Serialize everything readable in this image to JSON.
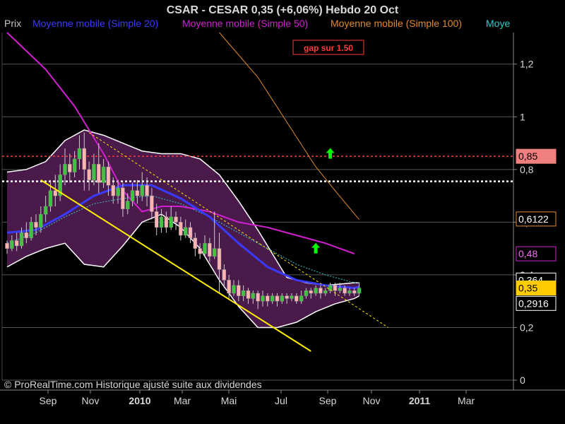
{
  "header": {
    "title": "CSAR - CESAR    0,35 (+6,06%)    Hebdo  20 Oct"
  },
  "legend": [
    {
      "label": "Prix",
      "color": "#c8c8c8"
    },
    {
      "label": "Moyenne mobile (Simple 20)",
      "color": "#3a3aff"
    },
    {
      "label": "Moyenne mobile (Simple 50)",
      "color": "#d21fd2"
    },
    {
      "label": "Moyenne mobile (Simple 100)",
      "color": "#e08a2e"
    },
    {
      "label": "Moye",
      "color": "#33cccc"
    }
  ],
  "annotation_gap": "gap sur 1.50",
  "footer": "© ProRealTime.com Historique ajusté suite aux dividendes",
  "colors": {
    "background": "#000000",
    "grid": "#555555",
    "bollinger_fill": "#4a1a4a",
    "bollinger_line": "#ffffff",
    "sma20": "#3a3aff",
    "sma50": "#d21fd2",
    "sma100": "#e08a2e",
    "extra": "#33cccc",
    "trendline": "#ffee00",
    "resistance": "#ff3b3b",
    "support": "#ffffff",
    "up_candle": "#3ec43e",
    "down_candle": "#ffb3b3",
    "arrow": "#00ff00"
  },
  "chart_data": {
    "type": "candlestick",
    "title": "CSAR - CESAR    0,35 (+6,06%)    Hebdo  20 Oct",
    "x_ticks": [
      {
        "label": "Sep",
        "bold": false
      },
      {
        "label": "Nov",
        "bold": false
      },
      {
        "label": "2010",
        "bold": true
      },
      {
        "label": "Mar",
        "bold": false
      },
      {
        "label": "Mai",
        "bold": false
      },
      {
        "label": "Jul",
        "bold": false
      },
      {
        "label": "Sep",
        "bold": false
      },
      {
        "label": "Nov",
        "bold": false
      },
      {
        "label": "2011",
        "bold": true
      },
      {
        "label": "Mar",
        "bold": false
      }
    ],
    "y_ticks": [
      "1,2",
      "1",
      "0,8",
      "0,6",
      "0,4",
      "0,2",
      "0"
    ],
    "y_tick_values": [
      1.2,
      1.0,
      0.8,
      0.6,
      0.4,
      0.2,
      0
    ],
    "ylim": [
      0,
      1.32
    ],
    "badges": [
      {
        "label": "0,85",
        "value": 0.85,
        "bg": "#f08080",
        "fg": "#000000",
        "border": "#f08080"
      },
      {
        "label": "0,6122",
        "value": 0.612,
        "bg": "#000000",
        "fg": "#ffffff",
        "border": "#e08a2e"
      },
      {
        "label": "0,48",
        "value": 0.48,
        "bg": "#000000",
        "fg": "#ff66ff",
        "border": "#d21fd2"
      },
      {
        "label": "0,364",
        "value": 0.38,
        "bg": "#000000",
        "fg": "#ffffff",
        "border": "#ffffff"
      },
      {
        "label": "0,35",
        "value": 0.35,
        "bg": "#ffcc00",
        "fg": "#000000",
        "border": "#ffcc00"
      },
      {
        "label": "0,2916",
        "value": 0.2916,
        "bg": "#000000",
        "fg": "#ffffff",
        "border": "#ffffff"
      }
    ],
    "levels": {
      "resistance": 0.85,
      "support": 0.755
    },
    "candles": [
      [
        0.52,
        0.5,
        0.48,
        0.53
      ],
      [
        0.5,
        0.53,
        0.49,
        0.55
      ],
      [
        0.53,
        0.51,
        0.49,
        0.56
      ],
      [
        0.51,
        0.56,
        0.5,
        0.58
      ],
      [
        0.56,
        0.54,
        0.52,
        0.6
      ],
      [
        0.54,
        0.6,
        0.53,
        0.62
      ],
      [
        0.6,
        0.58,
        0.55,
        0.63
      ],
      [
        0.58,
        0.63,
        0.56,
        0.66
      ],
      [
        0.63,
        0.66,
        0.6,
        0.7
      ],
      [
        0.66,
        0.72,
        0.64,
        0.76
      ],
      [
        0.72,
        0.7,
        0.66,
        0.78
      ],
      [
        0.7,
        0.78,
        0.68,
        0.82
      ],
      [
        0.78,
        0.82,
        0.74,
        0.88
      ],
      [
        0.82,
        0.79,
        0.75,
        0.86
      ],
      [
        0.79,
        0.84,
        0.77,
        0.87
      ],
      [
        0.84,
        0.88,
        0.8,
        0.93
      ],
      [
        0.88,
        0.8,
        0.72,
        0.94
      ],
      [
        0.8,
        0.76,
        0.72,
        0.83
      ],
      [
        0.76,
        0.82,
        0.74,
        0.86
      ],
      [
        0.82,
        0.75,
        0.71,
        0.9
      ],
      [
        0.75,
        0.81,
        0.73,
        0.84
      ],
      [
        0.81,
        0.74,
        0.7,
        0.83
      ],
      [
        0.74,
        0.7,
        0.67,
        0.77
      ],
      [
        0.7,
        0.73,
        0.67,
        0.76
      ],
      [
        0.73,
        0.65,
        0.62,
        0.75
      ],
      [
        0.65,
        0.68,
        0.63,
        0.71
      ],
      [
        0.68,
        0.72,
        0.66,
        0.75
      ],
      [
        0.72,
        0.7,
        0.67,
        0.76
      ],
      [
        0.7,
        0.74,
        0.68,
        0.79
      ],
      [
        0.74,
        0.7,
        0.66,
        0.77
      ],
      [
        0.7,
        0.64,
        0.61,
        0.73
      ],
      [
        0.64,
        0.58,
        0.55,
        0.67
      ],
      [
        0.58,
        0.62,
        0.56,
        0.65
      ],
      [
        0.62,
        0.58,
        0.56,
        0.64
      ],
      [
        0.58,
        0.62,
        0.57,
        0.66
      ],
      [
        0.62,
        0.6,
        0.57,
        0.64
      ],
      [
        0.6,
        0.55,
        0.53,
        0.62
      ],
      [
        0.55,
        0.58,
        0.54,
        0.61
      ],
      [
        0.58,
        0.54,
        0.52,
        0.6
      ],
      [
        0.54,
        0.5,
        0.47,
        0.56
      ],
      [
        0.5,
        0.48,
        0.46,
        0.52
      ],
      [
        0.48,
        0.52,
        0.47,
        0.55
      ],
      [
        0.52,
        0.47,
        0.45,
        0.54
      ],
      [
        0.47,
        0.5,
        0.46,
        0.64
      ],
      [
        0.5,
        0.42,
        0.33,
        0.56
      ],
      [
        0.42,
        0.38,
        0.35,
        0.44
      ],
      [
        0.38,
        0.33,
        0.31,
        0.4
      ],
      [
        0.33,
        0.36,
        0.32,
        0.38
      ],
      [
        0.36,
        0.32,
        0.3,
        0.38
      ],
      [
        0.32,
        0.34,
        0.3,
        0.36
      ],
      [
        0.34,
        0.31,
        0.29,
        0.35
      ],
      [
        0.31,
        0.33,
        0.29,
        0.34
      ],
      [
        0.33,
        0.3,
        0.27,
        0.34
      ],
      [
        0.3,
        0.32,
        0.28,
        0.34
      ],
      [
        0.32,
        0.3,
        0.28,
        0.33
      ],
      [
        0.3,
        0.32,
        0.29,
        0.33
      ],
      [
        0.32,
        0.3,
        0.28,
        0.33
      ],
      [
        0.3,
        0.32,
        0.29,
        0.33
      ],
      [
        0.32,
        0.31,
        0.29,
        0.33
      ],
      [
        0.31,
        0.32,
        0.3,
        0.33
      ],
      [
        0.32,
        0.3,
        0.29,
        0.33
      ],
      [
        0.3,
        0.32,
        0.29,
        0.34
      ],
      [
        0.32,
        0.34,
        0.31,
        0.35
      ],
      [
        0.34,
        0.33,
        0.31,
        0.35
      ],
      [
        0.33,
        0.35,
        0.32,
        0.36
      ],
      [
        0.35,
        0.33,
        0.31,
        0.36
      ],
      [
        0.33,
        0.34,
        0.32,
        0.35
      ],
      [
        0.34,
        0.36,
        0.33,
        0.37
      ],
      [
        0.36,
        0.34,
        0.32,
        0.37
      ],
      [
        0.34,
        0.35,
        0.33,
        0.37
      ],
      [
        0.35,
        0.33,
        0.32,
        0.36
      ],
      [
        0.33,
        0.34,
        0.32,
        0.35
      ],
      [
        0.34,
        0.33,
        0.32,
        0.35
      ],
      [
        0.33,
        0.35,
        0.32,
        0.37
      ]
    ],
    "sma20": [
      [
        0,
        0.56
      ],
      [
        6,
        0.57
      ],
      [
        12,
        0.63
      ],
      [
        18,
        0.7
      ],
      [
        24,
        0.74
      ],
      [
        30,
        0.74
      ],
      [
        36,
        0.69
      ],
      [
        42,
        0.62
      ],
      [
        48,
        0.52
      ],
      [
        54,
        0.43
      ],
      [
        60,
        0.38
      ],
      [
        66,
        0.36
      ],
      [
        72,
        0.35
      ],
      [
        73,
        0.355
      ]
    ],
    "sma50": [
      [
        0,
        1.32
      ],
      [
        8,
        1.18
      ],
      [
        14,
        1.04
      ],
      [
        20,
        0.86
      ],
      [
        24,
        0.72
      ],
      [
        28,
        0.64
      ],
      [
        32,
        0.66
      ],
      [
        36,
        0.66
      ],
      [
        42,
        0.64
      ],
      [
        48,
        0.6
      ],
      [
        54,
        0.58
      ],
      [
        60,
        0.55
      ],
      [
        66,
        0.52
      ],
      [
        72,
        0.48
      ]
    ],
    "sma100": [
      [
        44,
        1.32
      ],
      [
        52,
        1.15
      ],
      [
        58,
        0.98
      ],
      [
        64,
        0.81
      ],
      [
        68,
        0.72
      ],
      [
        73,
        0.61
      ]
    ],
    "extra_ma": [
      [
        0,
        0.52
      ],
      [
        6,
        0.56
      ],
      [
        12,
        0.62
      ],
      [
        18,
        0.67
      ],
      [
        24,
        0.69
      ],
      [
        30,
        0.7
      ],
      [
        36,
        0.67
      ],
      [
        42,
        0.62
      ],
      [
        48,
        0.56
      ],
      [
        54,
        0.5
      ],
      [
        60,
        0.44
      ],
      [
        66,
        0.4
      ],
      [
        72,
        0.37
      ],
      [
        73,
        0.37
      ]
    ],
    "boll_upper": [
      [
        0,
        0.79
      ],
      [
        4,
        0.8
      ],
      [
        8,
        0.83
      ],
      [
        12,
        0.91
      ],
      [
        16,
        0.95
      ],
      [
        20,
        0.93
      ],
      [
        24,
        0.9
      ],
      [
        28,
        0.87
      ],
      [
        32,
        0.86
      ],
      [
        36,
        0.86
      ],
      [
        40,
        0.84
      ],
      [
        44,
        0.78
      ],
      [
        48,
        0.68
      ],
      [
        52,
        0.57
      ],
      [
        56,
        0.45
      ],
      [
        58,
        0.39
      ],
      [
        62,
        0.37
      ],
      [
        66,
        0.36
      ],
      [
        72,
        0.37
      ],
      [
        73,
        0.37
      ]
    ],
    "boll_lower": [
      [
        0,
        0.43
      ],
      [
        4,
        0.47
      ],
      [
        8,
        0.5
      ],
      [
        12,
        0.52
      ],
      [
        16,
        0.44
      ],
      [
        20,
        0.43
      ],
      [
        24,
        0.51
      ],
      [
        28,
        0.6
      ],
      [
        32,
        0.63
      ],
      [
        36,
        0.58
      ],
      [
        40,
        0.5
      ],
      [
        44,
        0.38
      ],
      [
        48,
        0.28
      ],
      [
        52,
        0.2
      ],
      [
        56,
        0.2
      ],
      [
        60,
        0.22
      ],
      [
        64,
        0.26
      ],
      [
        68,
        0.29
      ],
      [
        72,
        0.31
      ],
      [
        73,
        0.32
      ]
    ],
    "trend_solid": [
      [
        7,
        0.76
      ],
      [
        63,
        0.11
      ]
    ],
    "trend_dashed": [
      [
        17,
        0.94
      ],
      [
        79,
        0.2
      ]
    ],
    "arrows": [
      {
        "index": 67,
        "value": 0.86
      },
      {
        "index": 64,
        "value": 0.5
      }
    ]
  }
}
